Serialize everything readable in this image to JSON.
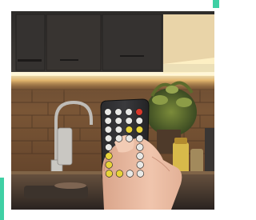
{
  "image": {
    "subject": "remote-control-led-strip-kitchen",
    "accent_color": "#3fd0a4",
    "frame_color": "#ffffff"
  },
  "remote": {
    "buttons": [
      {
        "row": 1,
        "colors": [
          "#e9e9e6",
          "#e9e9e6",
          "#e9e9e6",
          "#d9382b"
        ]
      },
      {
        "row": 2,
        "colors": [
          "#e9e9e6",
          "#e9e9e6",
          "#e9e9e6",
          "#e9e9e6"
        ]
      },
      {
        "row": 3,
        "colors": [
          "#e9e9e6",
          "#e9e9e6",
          "#e8d33a",
          "#e8d33a"
        ]
      },
      {
        "row": 4,
        "colors": [
          "#e9e9e6",
          "#e9e9e6",
          "#e9e9e6",
          "#e9e9e6"
        ]
      },
      {
        "row": 5,
        "colors": [
          "#e9e9e6",
          "#e9e9e6",
          "#e9e9e6",
          "#e9e9e6"
        ]
      },
      {
        "row": 6,
        "colors": [
          "#e8d33a",
          "#e8d33a",
          "#e9e9e6",
          "#e9e9e6"
        ]
      },
      {
        "row": 7,
        "colors": [
          "#e8d33a",
          "#e8d33a",
          "#e9e9e6",
          "#e9e9e6"
        ]
      },
      {
        "row": 8,
        "colors": [
          "#e8d33a",
          "#e8d33a",
          "#e9e9e6",
          "#e9e9e6"
        ]
      }
    ]
  }
}
